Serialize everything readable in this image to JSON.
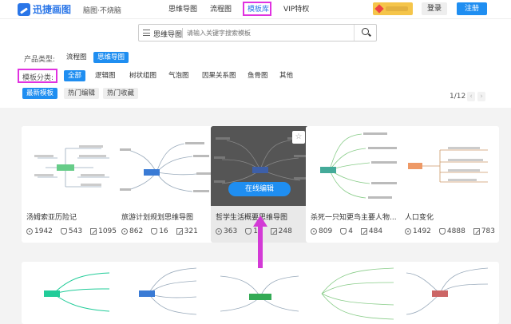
{
  "header": {
    "brand": "迅捷画图",
    "slogan": "脑图·不烧脑",
    "nav": [
      "思维导图",
      "流程图",
      "模板库",
      "VIP特权"
    ],
    "login": "登录",
    "register": "注册"
  },
  "search": {
    "category": "思维导图",
    "placeholder": "请输入关键字搜索模板"
  },
  "filters": {
    "product_label": "产品类型:",
    "products": [
      "流程图",
      "思维导图"
    ],
    "category_label": "模板分类:",
    "categories": [
      "全部",
      "逻辑图",
      "树状组图",
      "气泡图",
      "因果关系图",
      "鱼骨图",
      "其他"
    ],
    "sorts": [
      "最新模板",
      "热门编辑",
      "热门收藏"
    ],
    "page": "1/12",
    "prev": "‹",
    "next": "›"
  },
  "cards": [
    {
      "title": "汤姆索亚历险记",
      "views": "1942",
      "likes": "543",
      "edits": "1095"
    },
    {
      "title": "旅游计划规划思维导图",
      "views": "862",
      "likes": "16",
      "edits": "321"
    },
    {
      "title": "哲学生活概要思维导图",
      "views": "363",
      "likes": "16",
      "edits": "248",
      "hover": "在线编辑",
      "star": "☆"
    },
    {
      "title": "杀死一只知更鸟主要人物...",
      "views": "809",
      "likes": "4",
      "edits": "484"
    },
    {
      "title": "人口变化",
      "views": "1492",
      "likes": "4888",
      "edits": "783"
    }
  ]
}
